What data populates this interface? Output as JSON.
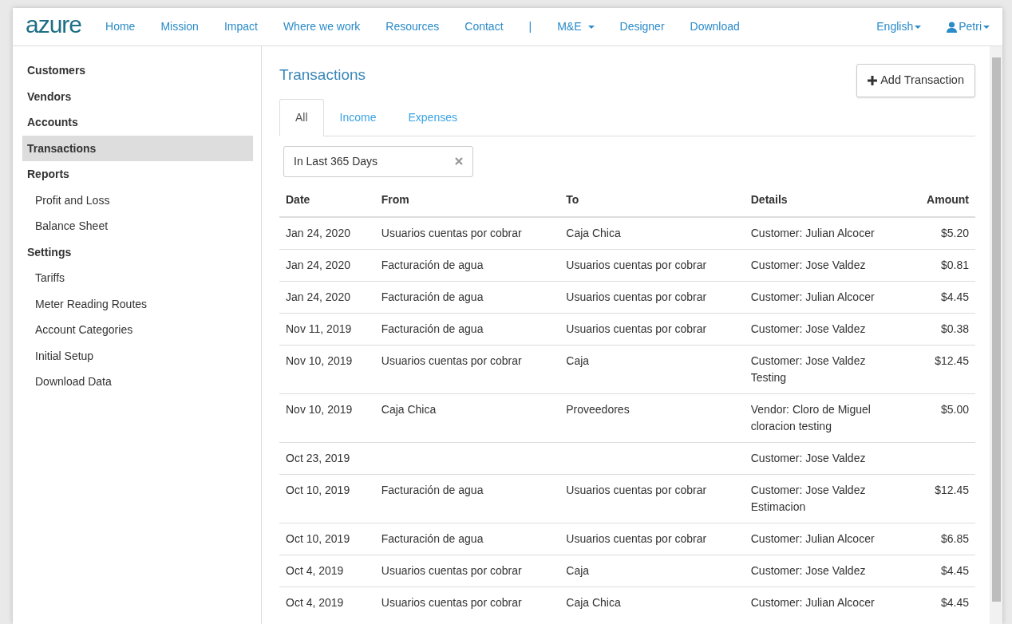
{
  "navbar": {
    "logo": "azure",
    "links": [
      {
        "label": "Home",
        "kind": "link"
      },
      {
        "label": "Mission",
        "kind": "link"
      },
      {
        "label": "Impact",
        "kind": "link"
      },
      {
        "label": "Where we work",
        "kind": "link"
      },
      {
        "label": "Resources",
        "kind": "link"
      },
      {
        "label": "Contact",
        "kind": "link"
      },
      {
        "label": "|",
        "kind": "separator"
      },
      {
        "label": "M&E",
        "kind": "dropdown"
      },
      {
        "label": "Designer",
        "kind": "link"
      },
      {
        "label": "Download",
        "kind": "link"
      }
    ],
    "right": [
      {
        "label": "English",
        "kind": "dropdown"
      },
      {
        "label": "Petri",
        "kind": "user"
      }
    ]
  },
  "sidebar": {
    "items": [
      {
        "label": "Customers",
        "kind": "section",
        "selected": false
      },
      {
        "label": "Vendors",
        "kind": "section",
        "selected": false
      },
      {
        "label": "Accounts",
        "kind": "section",
        "selected": false
      },
      {
        "label": "Transactions",
        "kind": "section",
        "selected": true
      },
      {
        "label": "Reports",
        "kind": "section",
        "selected": false
      },
      {
        "label": "Profit and Loss",
        "kind": "sub",
        "selected": false
      },
      {
        "label": "Balance Sheet",
        "kind": "sub",
        "selected": false
      },
      {
        "label": "Settings",
        "kind": "section",
        "selected": false
      },
      {
        "label": "Tariffs",
        "kind": "sub",
        "selected": false
      },
      {
        "label": "Meter Reading Routes",
        "kind": "sub",
        "selected": false
      },
      {
        "label": "Account Categories",
        "kind": "sub",
        "selected": false
      },
      {
        "label": "Initial Setup",
        "kind": "sub",
        "selected": false
      },
      {
        "label": "Download Data",
        "kind": "sub",
        "selected": false
      }
    ]
  },
  "main": {
    "title": "Transactions",
    "add_button": "Add Transaction",
    "tabs": [
      {
        "label": "All",
        "selected": true
      },
      {
        "label": "Income",
        "selected": false
      },
      {
        "label": "Expenses",
        "selected": false
      }
    ],
    "filter": {
      "value": "In Last 365 Days"
    },
    "table": {
      "columns": [
        "Date",
        "From",
        "To",
        "Details",
        "Amount"
      ],
      "rows": [
        {
          "date": "Jan 24, 2020",
          "from": "Usuarios cuentas por cobrar",
          "to": "Caja Chica",
          "details": [
            "Customer: Julian Alcocer"
          ],
          "amount": "$5.20"
        },
        {
          "date": "Jan 24, 2020",
          "from": "Facturación de agua",
          "to": "Usuarios cuentas por cobrar",
          "details": [
            "Customer: Jose Valdez"
          ],
          "amount": "$0.81"
        },
        {
          "date": "Jan 24, 2020",
          "from": "Facturación de agua",
          "to": "Usuarios cuentas por cobrar",
          "details": [
            "Customer: Julian Alcocer"
          ],
          "amount": "$4.45"
        },
        {
          "date": "Nov 11, 2019",
          "from": "Facturación de agua",
          "to": "Usuarios cuentas por cobrar",
          "details": [
            "Customer: Jose Valdez"
          ],
          "amount": "$0.38"
        },
        {
          "date": "Nov 10, 2019",
          "from": "Usuarios cuentas por cobrar",
          "to": "Caja",
          "details": [
            "Customer: Jose Valdez",
            "Testing"
          ],
          "amount": "$12.45"
        },
        {
          "date": "Nov 10, 2019",
          "from": "Caja Chica",
          "to": "Proveedores",
          "details": [
            "Vendor: Cloro de Miguel",
            "cloracion testing"
          ],
          "amount": "$5.00"
        },
        {
          "date": "Oct 23, 2019",
          "from": "",
          "to": "",
          "details": [
            "Customer: Jose Valdez"
          ],
          "amount": ""
        },
        {
          "date": "Oct 10, 2019",
          "from": "Facturación de agua",
          "to": "Usuarios cuentas por cobrar",
          "details": [
            "Customer: Jose Valdez",
            "Estimacion"
          ],
          "amount": "$12.45"
        },
        {
          "date": "Oct 10, 2019",
          "from": "Facturación de agua",
          "to": "Usuarios cuentas por cobrar",
          "details": [
            "Customer: Julian Alcocer"
          ],
          "amount": "$6.85"
        },
        {
          "date": "Oct 4, 2019",
          "from": "Usuarios cuentas por cobrar",
          "to": "Caja",
          "details": [
            "Customer: Jose Valdez"
          ],
          "amount": "$4.45"
        },
        {
          "date": "Oct 4, 2019",
          "from": "Usuarios cuentas por cobrar",
          "to": "Caja Chica",
          "details": [
            "Customer: Julian Alcocer"
          ],
          "amount": "$4.45"
        }
      ]
    }
  }
}
